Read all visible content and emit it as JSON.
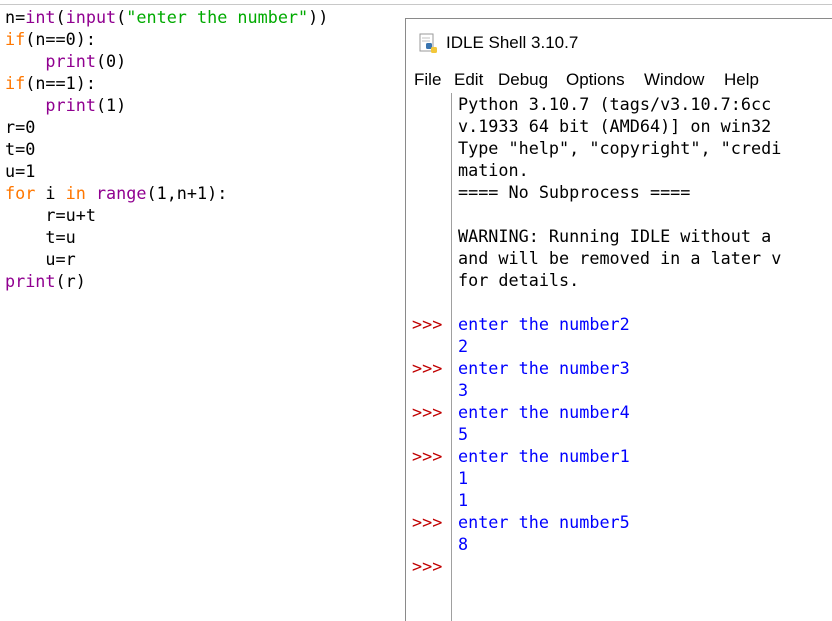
{
  "editor": {
    "lines": [
      [
        {
          "t": "n=",
          "c": ""
        },
        {
          "t": "int",
          "c": "bi"
        },
        {
          "t": "(",
          "c": ""
        },
        {
          "t": "input",
          "c": "bi"
        },
        {
          "t": "(",
          "c": ""
        },
        {
          "t": "\"enter the number\"",
          "c": "str"
        },
        {
          "t": "))",
          "c": ""
        }
      ],
      [
        {
          "t": "if",
          "c": "kw"
        },
        {
          "t": "(n==0):",
          "c": ""
        }
      ],
      [
        {
          "t": "    ",
          "c": ""
        },
        {
          "t": "print",
          "c": "bi"
        },
        {
          "t": "(0)",
          "c": ""
        }
      ],
      [
        {
          "t": "if",
          "c": "kw"
        },
        {
          "t": "(n==1):",
          "c": ""
        }
      ],
      [
        {
          "t": "    ",
          "c": ""
        },
        {
          "t": "print",
          "c": "bi"
        },
        {
          "t": "(1)",
          "c": ""
        }
      ],
      [
        {
          "t": "r=0",
          "c": ""
        }
      ],
      [
        {
          "t": "t=0",
          "c": ""
        }
      ],
      [
        {
          "t": "u=1",
          "c": ""
        }
      ],
      [
        {
          "t": "for",
          "c": "kw"
        },
        {
          "t": " i ",
          "c": ""
        },
        {
          "t": "in",
          "c": "kw"
        },
        {
          "t": " ",
          "c": ""
        },
        {
          "t": "range",
          "c": "bi"
        },
        {
          "t": "(1,n+1):",
          "c": ""
        }
      ],
      [
        {
          "t": "    r=u+t",
          "c": ""
        }
      ],
      [
        {
          "t": "    t=u",
          "c": ""
        }
      ],
      [
        {
          "t": "    u=r",
          "c": ""
        }
      ],
      [
        {
          "t": "print",
          "c": "bi"
        },
        {
          "t": "(r)",
          "c": ""
        }
      ]
    ]
  },
  "shell": {
    "title": "IDLE Shell 3.10.7",
    "app_icon": "python-idle-icon",
    "menu": [
      "File",
      "Edit",
      "Debug",
      "Options",
      "Window",
      "Help"
    ],
    "prompt": ">>>",
    "banner": [
      "Python 3.10.7 (tags/v3.10.7:6cc",
      "v.1933 64 bit (AMD64)] on win32",
      "Type \"help\", \"copyright\", \"credi",
      "mation.",
      "==== No Subprocess ====",
      "",
      "WARNING: Running IDLE without a",
      "and will be removed in a later v",
      "for details.",
      ""
    ],
    "session": [
      {
        "prompt": true,
        "text": "enter the number2",
        "kind": "input"
      },
      {
        "prompt": false,
        "text": "2",
        "kind": "stdout"
      },
      {
        "prompt": true,
        "text": "enter the number3",
        "kind": "input"
      },
      {
        "prompt": false,
        "text": "3",
        "kind": "stdout"
      },
      {
        "prompt": true,
        "text": "enter the number4",
        "kind": "input"
      },
      {
        "prompt": false,
        "text": "5",
        "kind": "stdout"
      },
      {
        "prompt": true,
        "text": "enter the number1",
        "kind": "input"
      },
      {
        "prompt": false,
        "text": "1",
        "kind": "stdout"
      },
      {
        "prompt": false,
        "text": "1",
        "kind": "stdout"
      },
      {
        "prompt": true,
        "text": "enter the number5",
        "kind": "input"
      },
      {
        "prompt": false,
        "text": "8",
        "kind": "stdout"
      },
      {
        "prompt": true,
        "text": "",
        "kind": "input"
      }
    ]
  }
}
